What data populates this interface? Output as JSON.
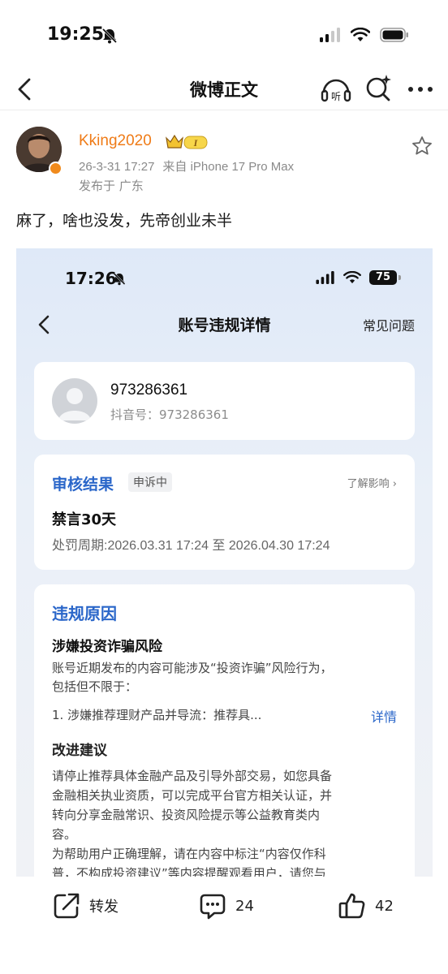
{
  "status_bar": {
    "time": "19:25"
  },
  "nav": {
    "title": "微博正文",
    "listen_label": "听"
  },
  "author": {
    "username": "Kking2020",
    "vip_level": "I",
    "date": "26-3-31 17:27",
    "source": "来自 iPhone 17 Pro Max",
    "location": "发布于 广东"
  },
  "post": {
    "text": "麻了，啥也没发，先帝创业未半"
  },
  "embedded": {
    "status_bar": {
      "time": "17:26",
      "battery": "75"
    },
    "header": {
      "title": "账号违规详情",
      "faq": "常见问题"
    },
    "account": {
      "name": "973286361",
      "douyin_id": "抖音号：973286361"
    },
    "review": {
      "title": "审核结果",
      "status_tag": "申诉中",
      "impact_link": "了解影响 ›",
      "penalty": "禁言30天",
      "period": "处罚周期:2026.03.31 17:24 至 2026.04.30 17:24"
    },
    "violation": {
      "title": "违规原因",
      "subtitle": "涉嫌投资诈骗风险",
      "desc_line1": "账号近期发布的内容可能涉及“投资诈骗”风险行为，",
      "desc_line2": "包括但不限于：",
      "item1": "1. 涉嫌推荐理财产品并导流：推荐具...",
      "detail_link": "详情",
      "advice_title": "改进建议",
      "advice_line1": "请停止推荐具体金融产品及引导外部交易，如您具备",
      "advice_line2": "金融相关执业资质，可以完成平台官方相关认证，并",
      "advice_line3": "转向分享金融常识、投资风险提示等公益教育类内",
      "advice_line4": "容。",
      "advice_line5": "为帮助用户正确理解，请在内容中标注“内容仅作科",
      "advice_line6": "普，不构成投资建议”等内容提醒观看用户，请您与"
    }
  },
  "actions": {
    "repost": "转发",
    "comments": "24",
    "likes": "42"
  },
  "colors": {
    "username": "#ef7b17",
    "link_blue": "#2a66c9"
  }
}
